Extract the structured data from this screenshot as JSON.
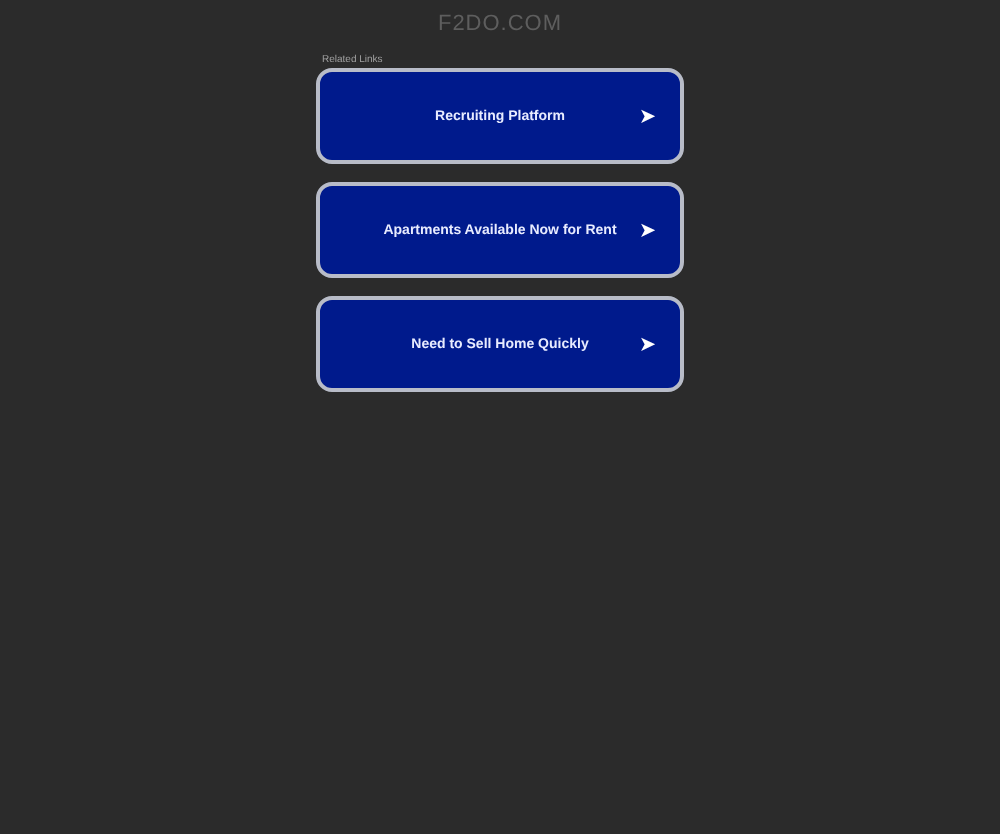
{
  "site_title": "F2DO.COM",
  "links_heading": "Related Links",
  "links": [
    {
      "label": "Recruiting Platform",
      "arrow": "➤"
    },
    {
      "label": "Apartments Available Now for Rent",
      "arrow": "➤"
    },
    {
      "label": "Need to Sell Home Quickly",
      "arrow": "➤"
    }
  ]
}
